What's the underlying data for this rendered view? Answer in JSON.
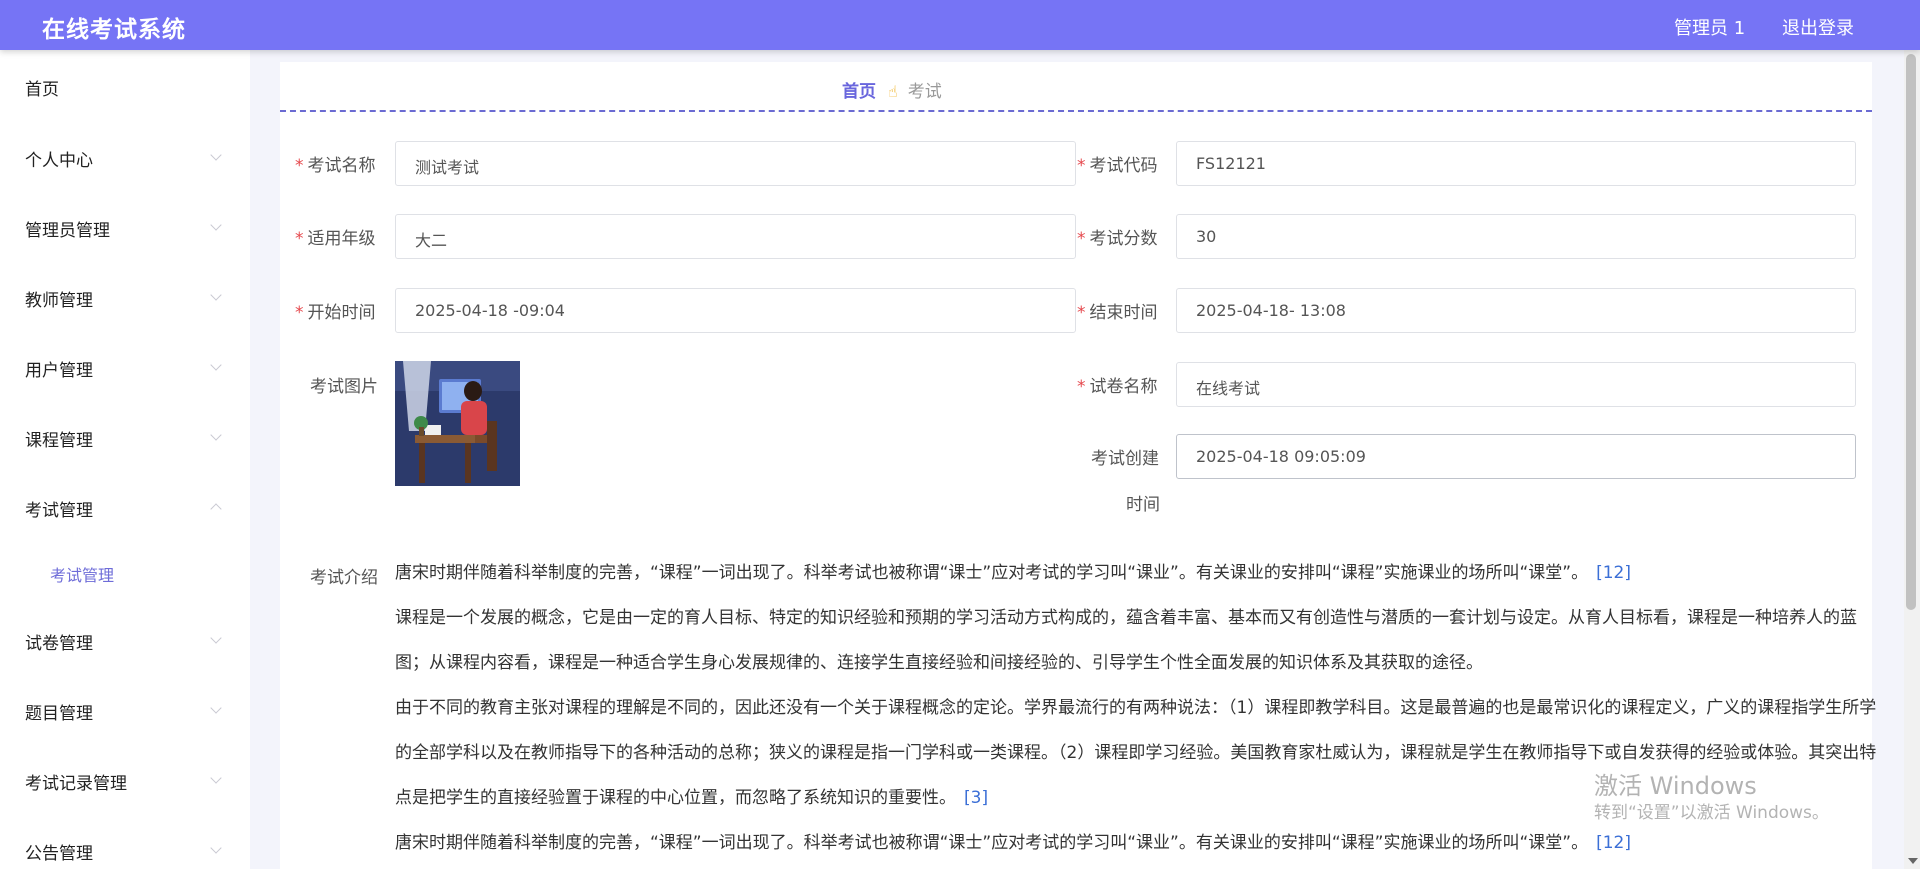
{
  "header": {
    "app_title": "在线考试系统",
    "user_label": "管理员 1",
    "logout_label": "退出登录"
  },
  "sidebar": {
    "items": [
      {
        "label": "首页",
        "has_arrow": false
      },
      {
        "label": "个人中心",
        "has_arrow": true
      },
      {
        "label": "管理员管理",
        "has_arrow": true
      },
      {
        "label": "教师管理",
        "has_arrow": true
      },
      {
        "label": "用户管理",
        "has_arrow": true
      },
      {
        "label": "课程管理",
        "has_arrow": true
      },
      {
        "label": "考试管理",
        "has_arrow": true,
        "expanded": true
      },
      {
        "label": "试卷管理",
        "has_arrow": true
      },
      {
        "label": "题目管理",
        "has_arrow": true
      },
      {
        "label": "考试记录管理",
        "has_arrow": true
      },
      {
        "label": "公告管理",
        "has_arrow": true
      }
    ],
    "sub_items": [
      {
        "label": "考试管理",
        "active": true
      }
    ]
  },
  "breadcrumb": {
    "home": "首页",
    "separator_icon": "hand-pointing-icon",
    "current": "考试"
  },
  "form": {
    "exam_name_label": "考试名称",
    "exam_name_value": "测试考试",
    "exam_code_label": "考试代码",
    "exam_code_value": "FS12121",
    "grade_label": "适用年级",
    "grade_value": "大二",
    "score_label": "考试分数",
    "score_value": "30",
    "start_label": "开始时间",
    "start_value": "2025-04-18 -09:04",
    "end_label": "结束时间",
    "end_value": "2025-04-18- 13:08",
    "image_label": "考试图片",
    "paper_label": "试卷名称",
    "paper_value": "在线考试",
    "created_label_1": "考试创建",
    "created_label_2": "时间",
    "created_value": "2025-04-18 09:05:09",
    "required_mark": "*"
  },
  "intro": {
    "label": "考试介绍",
    "paragraphs": [
      {
        "text": "唐宋时期伴随着科举制度的完善，“课程”一词出现了。科举考试也被称谓“课士”应对考试的学习叫“课业”。有关课业的安排叫“课程”实施课业的场所叫“课堂”。",
        "ref": "[12]"
      },
      {
        "text": "课程是一个发展的概念，它是由一定的育人目标、特定的知识经验和预期的学习活动方式构成的，蕴含着丰富、基本而又有创造性与潜质的一套计划与设定。从育人目标看，课程是一种培养人的蓝图；从课程内容看，课程是一种适合学生身心发展规律的、连接学生直接经验和间接经验的、引导学生个性全面发展的知识体系及其获取的途径。",
        "ref": ""
      },
      {
        "text": "由于不同的教育主张对课程的理解是不同的，因此还没有一个关于课程概念的定论。学界最流行的有两种说法：（1）课程即教学科目。这是最普遍的也是最常识化的课程定义，广义的课程指学生所学的全部学科以及在教师指导下的各种活动的总称；狭义的课程是指一门学科或一类课程。（2）课程即学习经验。美国教育家杜威认为，课程就是学生在教师指导下或自发获得的经验或体验。其突出特点是把学生的直接经验置于课程的中心位置，而忽略了系统知识的重要性。",
        "ref": "[3]"
      },
      {
        "text": "唐宋时期伴随着科举制度的完善，“课程”一词出现了。科举考试也被称谓“课士”应对考试的学习叫“课业”。有关课业的安排叫“课程”实施课业的场所叫“课堂”。",
        "ref": "[12]"
      }
    ]
  },
  "watermark": {
    "line1": "激活 Windows",
    "line2": "转到“设置”以激活 Windows。"
  },
  "colors": {
    "header_bg": "#7674f5",
    "accent": "#6966dd",
    "required": "#e5484d",
    "link_ref": "#3b6fd6"
  }
}
